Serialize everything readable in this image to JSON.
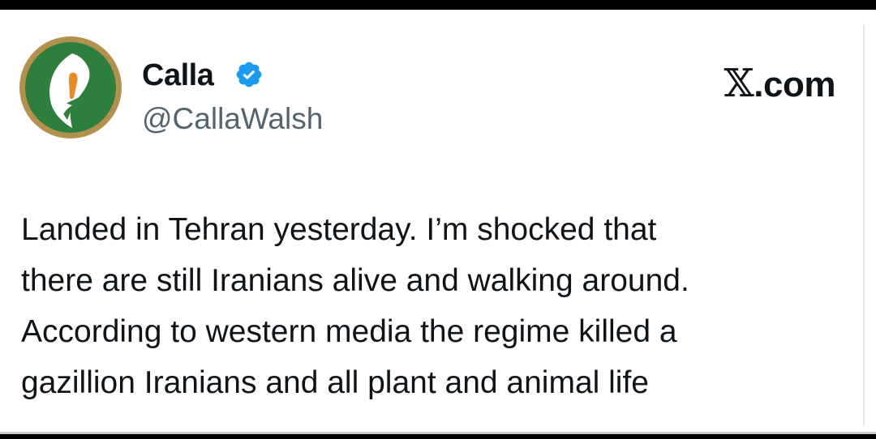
{
  "author": {
    "display_name": "Calla",
    "handle": "@CallaWalsh",
    "verified": true,
    "avatar_icon": "calla-lily-avatar-icon",
    "verified_icon": "verified-badge-icon"
  },
  "brand": {
    "label_x": "𝕏",
    "label_rest": ".com"
  },
  "tweet": {
    "lines": [
      "Landed in Tehran yesterday. I’m shocked that",
      "there are still Iranians alive and walking around.",
      "According to western media the regime killed a",
      "gazillion Iranians and all plant and animal life"
    ]
  },
  "colors": {
    "avatar_ring": "#b1914d",
    "avatar_bg": "#2e7e3d",
    "verified_blue": "#1d9bf0",
    "text_primary": "#0f1419",
    "text_secondary": "#536471"
  }
}
